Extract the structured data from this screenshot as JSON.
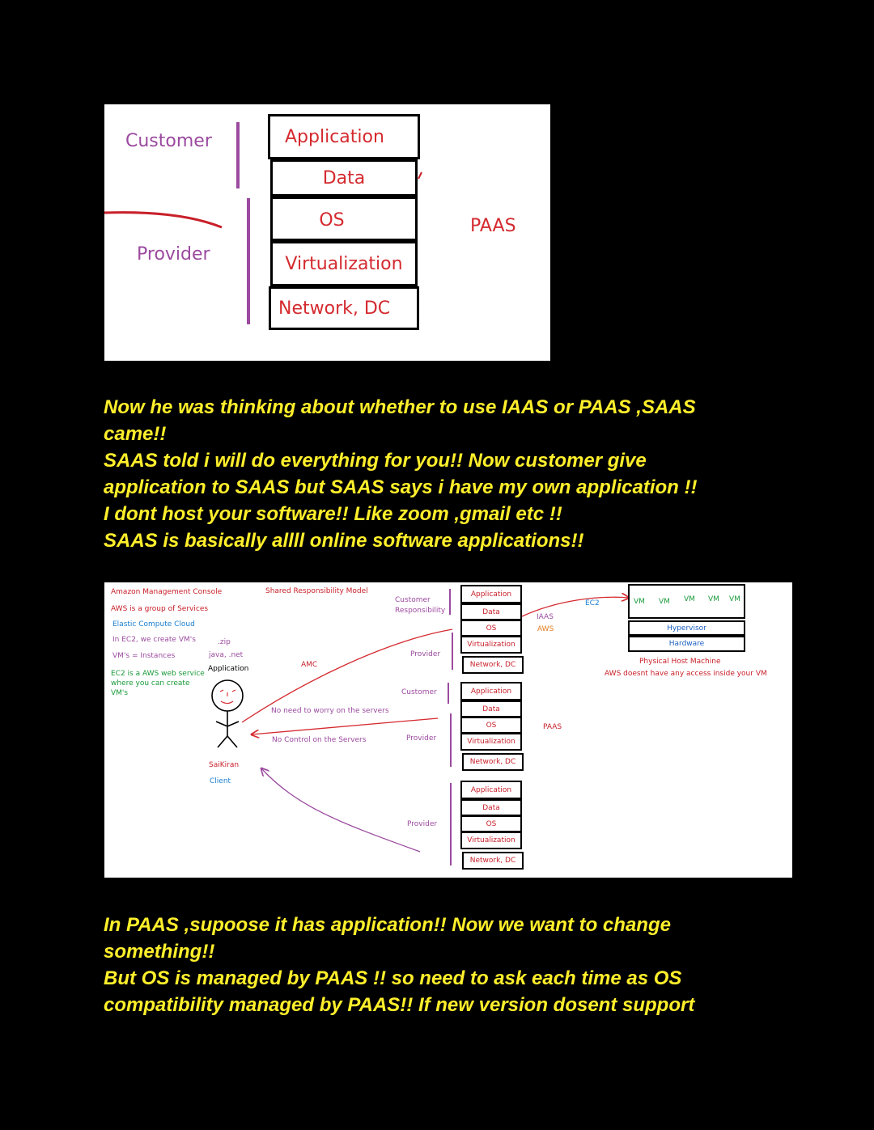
{
  "diagram1": {
    "customer_label": "Customer",
    "provider_label": "Provider",
    "stack": [
      "Application",
      "Data",
      "OS",
      "Virtualization",
      "Network, DC"
    ],
    "model_label": "PAAS"
  },
  "paragraph1": [
    "Now he was thinking about whether to use IAAS or PAAS ,SAAS",
    "came!!",
    "SAAS told i will do everything for you!! Now customer give",
    "application to SAAS but SAAS says i have my own application !!",
    "I dont host your software!! Like zoom ,gmail etc !!",
    "SAAS is basically allll online software applications!!"
  ],
  "diagram2": {
    "notes": {
      "console": "Amazon Management Console",
      "group": "AWS is a group of Services",
      "ecc": "Elastic Compute Cloud",
      "ec2_vms": "In EC2, we create VM's",
      "instances": "VM's = Instances",
      "web_service": [
        "EC2 is a AWS web service",
        "where you can create",
        "VM's"
      ],
      "zip": ".zip",
      "java": "java, .net",
      "application": "Application",
      "client_name": "SaiKiran",
      "client": "Client",
      "srm": "Shared Responsibility Model",
      "amc": "AMC",
      "no_worry": "No need to worry on the servers",
      "no_control": "No Control on the Servers"
    },
    "group1": {
      "customer_label": [
        "Customer",
        "Responsibility"
      ],
      "provider_label": "Provider",
      "stack": [
        "Application",
        "Data",
        "OS",
        "Virtualization",
        "Network, DC"
      ],
      "model_label": "IAAS",
      "vendor": "AWS"
    },
    "group2": {
      "customer_label": "Customer",
      "provider_label": "Provider",
      "stack": [
        "Application",
        "Data",
        "OS",
        "Virtualization",
        "Network, DC"
      ],
      "model_label": "PAAS"
    },
    "group3": {
      "provider_label": "Provider",
      "stack": [
        "Application",
        "Data",
        "OS",
        "Virtualization",
        "Network, DC"
      ]
    },
    "ec2": {
      "label": "EC2",
      "vms": [
        "VM",
        "VM",
        "VM",
        "VM",
        "VM"
      ],
      "hypervisor": "Hypervisor",
      "hardware": "Hardware",
      "host": "Physical Host Machine",
      "note": "AWS doesnt have any access inside your VM"
    }
  },
  "paragraph2": [
    "In PAAS ,supoose it has application!! Now we want to change",
    "something!!",
    "But OS is managed by PAAS !! so need to ask each time as OS",
    "compatibility managed by PAAS!! If new version dosent support"
  ],
  "colors": {
    "background": "#000000",
    "caption": "#ffef2b",
    "red": "#d42a2f",
    "purple": "#9b4a9f"
  }
}
